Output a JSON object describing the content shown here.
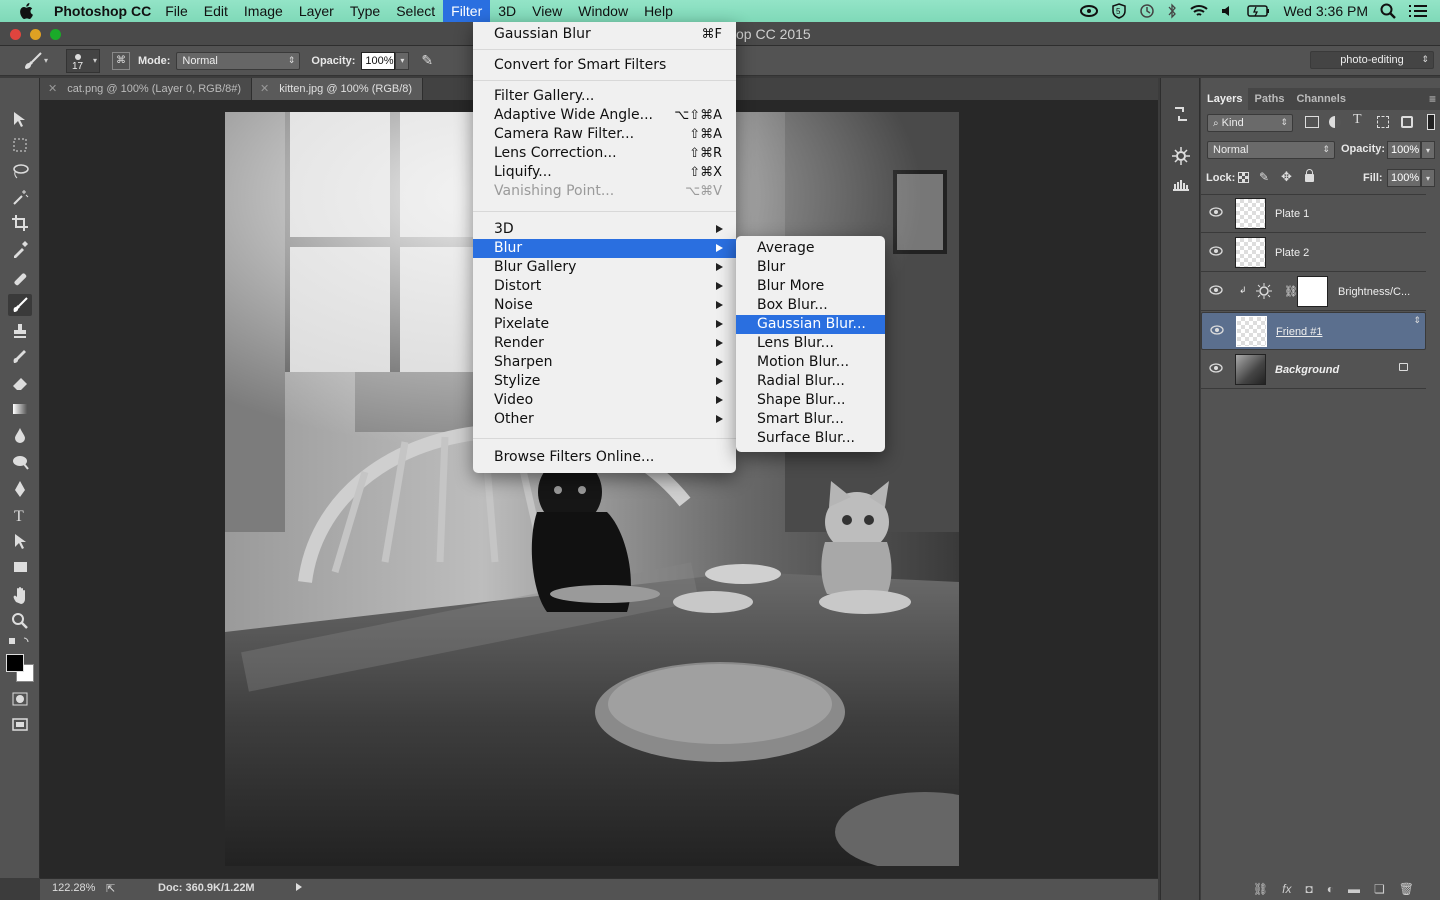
{
  "menubar": {
    "app_name": "Photoshop CC",
    "items": [
      "File",
      "Edit",
      "Image",
      "Layer",
      "Type",
      "Select",
      "Filter",
      "3D",
      "View",
      "Window",
      "Help"
    ],
    "active_item": "Filter",
    "clock": "Wed 3:36 PM"
  },
  "window": {
    "title_visible": "op CC 2015"
  },
  "options": {
    "brush_size": "17",
    "mode_label": "Mode:",
    "mode_value": "Normal",
    "opacity_label": "Opacity:",
    "opacity_value": "100%",
    "workspace": "photo-editing"
  },
  "tabs": [
    {
      "label": "cat.png @ 100% (Layer 0, RGB/8#)",
      "active": false
    },
    {
      "label": "kitten.jpg @ 100% (RGB/8)",
      "active": true
    }
  ],
  "status": {
    "zoom": "122.28%",
    "doc": "Doc: 360.9K/1.22M"
  },
  "filter_menu": {
    "items": [
      {
        "label": "Gaussian Blur",
        "shortcut": "⌘F"
      },
      {
        "label": "Convert for Smart Filters",
        "shortcut": ""
      },
      {
        "label": "Filter Gallery...",
        "shortcut": ""
      },
      {
        "label": "Adaptive Wide Angle...",
        "shortcut": "⌥⇧⌘A"
      },
      {
        "label": "Camera Raw Filter...",
        "shortcut": "⇧⌘A"
      },
      {
        "label": "Lens Correction...",
        "shortcut": "⇧⌘R"
      },
      {
        "label": "Liquify...",
        "shortcut": "⇧⌘X"
      },
      {
        "label": "Vanishing Point...",
        "shortcut": "⌥⌘V",
        "disabled": true
      },
      {
        "label": "3D",
        "submenu": true
      },
      {
        "label": "Blur",
        "submenu": true,
        "highlighted": true
      },
      {
        "label": "Blur Gallery",
        "submenu": true
      },
      {
        "label": "Distort",
        "submenu": true
      },
      {
        "label": "Noise",
        "submenu": true
      },
      {
        "label": "Pixelate",
        "submenu": true
      },
      {
        "label": "Render",
        "submenu": true
      },
      {
        "label": "Sharpen",
        "submenu": true
      },
      {
        "label": "Stylize",
        "submenu": true
      },
      {
        "label": "Video",
        "submenu": true
      },
      {
        "label": "Other",
        "submenu": true
      },
      {
        "label": "Browse Filters Online...",
        "shortcut": ""
      }
    ]
  },
  "blur_submenu": {
    "items": [
      "Average",
      "Blur",
      "Blur More",
      "Box Blur...",
      "Gaussian Blur...",
      "Lens Blur...",
      "Motion Blur...",
      "Radial Blur...",
      "Shape Blur...",
      "Smart Blur...",
      "Surface Blur..."
    ],
    "highlighted": "Gaussian Blur..."
  },
  "layers_panel": {
    "tabs": [
      "Layers",
      "Paths",
      "Channels"
    ],
    "kind_label": "Kind",
    "blend_mode": "Normal",
    "opacity_label": "Opacity:",
    "opacity_value": "100%",
    "lock_label": "Lock:",
    "fill_label": "Fill:",
    "fill_value": "100%",
    "layers": [
      {
        "name": "Plate 1"
      },
      {
        "name": "Plate 2"
      },
      {
        "name": "Brightness/C..."
      },
      {
        "name": "Friend #1",
        "selected": true
      },
      {
        "name": "Background",
        "locked": true
      }
    ]
  },
  "colors": {
    "menubar_bg": "#7fd9b8",
    "highlight": "#2a6fe0",
    "selected_layer": "#5b6f8e"
  }
}
